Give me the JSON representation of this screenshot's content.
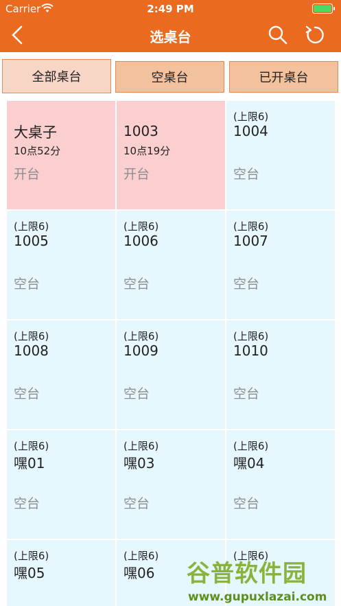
{
  "status_bar": {
    "carrier": "Carrier",
    "time": "2:49 PM"
  },
  "nav": {
    "title": "选桌台"
  },
  "tabs": [
    {
      "label": "全部桌台",
      "active": true
    },
    {
      "label": "空桌台",
      "active": false
    },
    {
      "label": "已开桌台",
      "active": false
    }
  ],
  "tables": [
    {
      "capacity": "",
      "name": "大桌子",
      "time": "10点52分",
      "status": "开台",
      "occupied": true
    },
    {
      "capacity": "",
      "name": "1003",
      "time": "10点19分",
      "status": "开台",
      "occupied": true
    },
    {
      "capacity": "(上限6)",
      "name": "1004",
      "time": "",
      "status": "空台",
      "occupied": false
    },
    {
      "capacity": "(上限6)",
      "name": "1005",
      "time": "",
      "status": "空台",
      "occupied": false
    },
    {
      "capacity": "(上限6)",
      "name": "1006",
      "time": "",
      "status": "空台",
      "occupied": false
    },
    {
      "capacity": "(上限6)",
      "name": "1007",
      "time": "",
      "status": "空台",
      "occupied": false
    },
    {
      "capacity": "(上限6)",
      "name": "1008",
      "time": "",
      "status": "空台",
      "occupied": false
    },
    {
      "capacity": "(上限6)",
      "name": "1009",
      "time": "",
      "status": "空台",
      "occupied": false
    },
    {
      "capacity": "(上限6)",
      "name": "1010",
      "time": "",
      "status": "空台",
      "occupied": false
    },
    {
      "capacity": "(上限6)",
      "name": "嘿01",
      "time": "",
      "status": "空台",
      "occupied": false
    },
    {
      "capacity": "(上限6)",
      "name": "嘿03",
      "time": "",
      "status": "空台",
      "occupied": false
    },
    {
      "capacity": "(上限6)",
      "name": "嘿04",
      "time": "",
      "status": "空台",
      "occupied": false
    },
    {
      "capacity": "(上限6)",
      "name": "嘿05",
      "time": "",
      "status": "",
      "occupied": false
    },
    {
      "capacity": "(上限6)",
      "name": "嘿06",
      "time": "",
      "status": "",
      "occupied": false
    },
    {
      "capacity": "(上限6)",
      "name": "",
      "time": "",
      "status": "",
      "occupied": false
    }
  ],
  "watermark": {
    "title": "谷普软件园",
    "url": "www.gupuxlazai.com"
  },
  "colors": {
    "accent": "#ea6a1f",
    "occupied": "#fbcfcf",
    "free": "#e6f7fe"
  }
}
